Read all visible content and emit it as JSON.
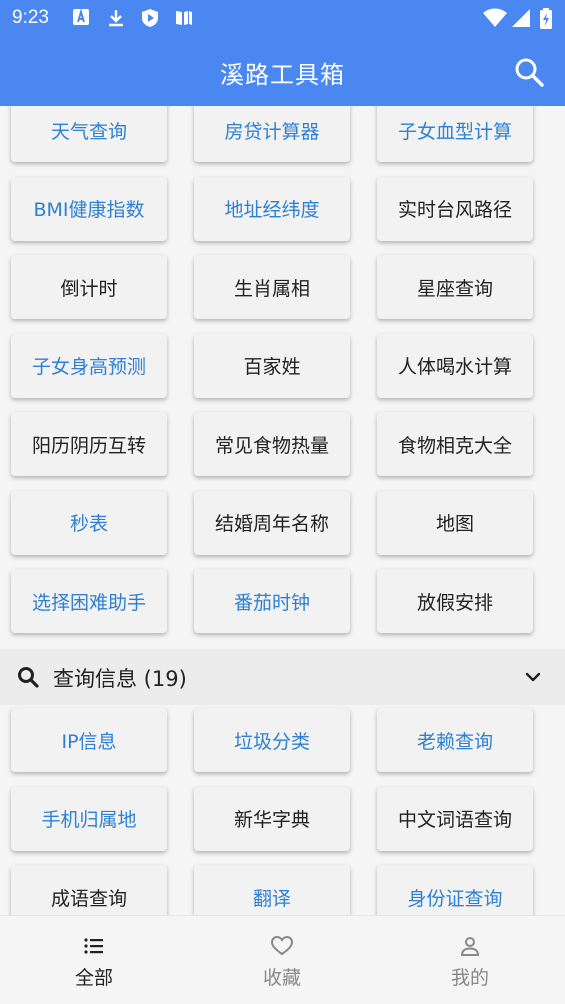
{
  "status": {
    "time": "9:23"
  },
  "appbar": {
    "title": "溪路工具箱",
    "search_icon": "search-icon"
  },
  "tools": [
    {
      "label": "天气查询",
      "color": "blue"
    },
    {
      "label": "房贷计算器",
      "color": "blue"
    },
    {
      "label": "子女血型计算",
      "color": "blue"
    },
    {
      "label": "BMI健康指数",
      "color": "blue"
    },
    {
      "label": "地址经纬度",
      "color": "blue"
    },
    {
      "label": "实时台风路径",
      "color": "dark"
    },
    {
      "label": "倒计时",
      "color": "dark"
    },
    {
      "label": "生肖属相",
      "color": "dark"
    },
    {
      "label": "星座查询",
      "color": "dark"
    },
    {
      "label": "子女身高预测",
      "color": "blue"
    },
    {
      "label": "百家姓",
      "color": "dark"
    },
    {
      "label": "人体喝水计算",
      "color": "dark"
    },
    {
      "label": "阳历阴历互转",
      "color": "dark"
    },
    {
      "label": "常见食物热量",
      "color": "dark"
    },
    {
      "label": "食物相克大全",
      "color": "dark"
    },
    {
      "label": "秒表",
      "color": "blue"
    },
    {
      "label": "结婚周年名称",
      "color": "dark"
    },
    {
      "label": "地图",
      "color": "dark"
    },
    {
      "label": "选择困难助手",
      "color": "blue"
    },
    {
      "label": "番茄时钟",
      "color": "blue"
    },
    {
      "label": "放假安排",
      "color": "dark"
    }
  ],
  "query_section": {
    "title": "查询信息 (19)",
    "items": [
      {
        "label": "IP信息",
        "color": "blue"
      },
      {
        "label": "垃圾分类",
        "color": "blue"
      },
      {
        "label": "老赖查询",
        "color": "blue"
      },
      {
        "label": "手机归属地",
        "color": "blue"
      },
      {
        "label": "新华字典",
        "color": "dark"
      },
      {
        "label": "中文词语查询",
        "color": "dark"
      },
      {
        "label": "成语查询",
        "color": "dark"
      },
      {
        "label": "翻译",
        "color": "blue"
      },
      {
        "label": "身份证查询",
        "color": "blue"
      }
    ]
  },
  "bottom_nav": [
    {
      "label": "全部",
      "icon": "list-icon",
      "active": true
    },
    {
      "label": "收藏",
      "icon": "heart-icon",
      "active": false
    },
    {
      "label": "我的",
      "icon": "person-icon",
      "active": false
    }
  ]
}
